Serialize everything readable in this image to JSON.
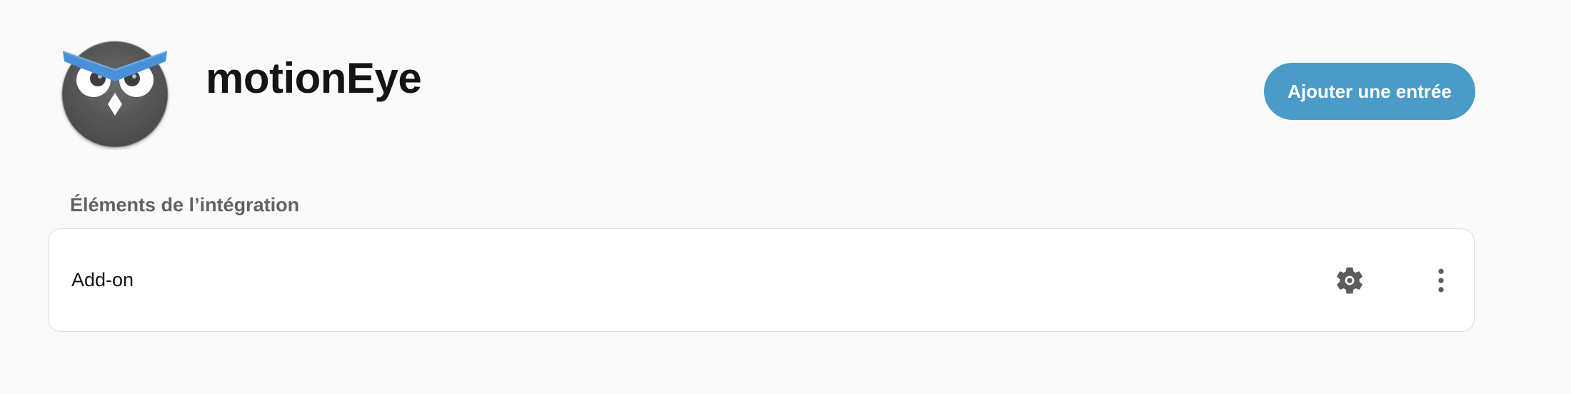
{
  "header": {
    "logo_icon": "motioneye-owl-logo",
    "title": "motionEye",
    "add_entry_label": "Ajouter une entrée"
  },
  "section": {
    "title": "Éléments de l’intégration"
  },
  "entries": [
    {
      "label": "Add-on",
      "actions": [
        "gear-icon",
        "more-vertical-icon"
      ]
    }
  ],
  "colors": {
    "background": "#fafafa",
    "primary_button": "#4a9bc7",
    "owl_body": "#5a5a5a",
    "owl_brow": "#4a90d9"
  }
}
